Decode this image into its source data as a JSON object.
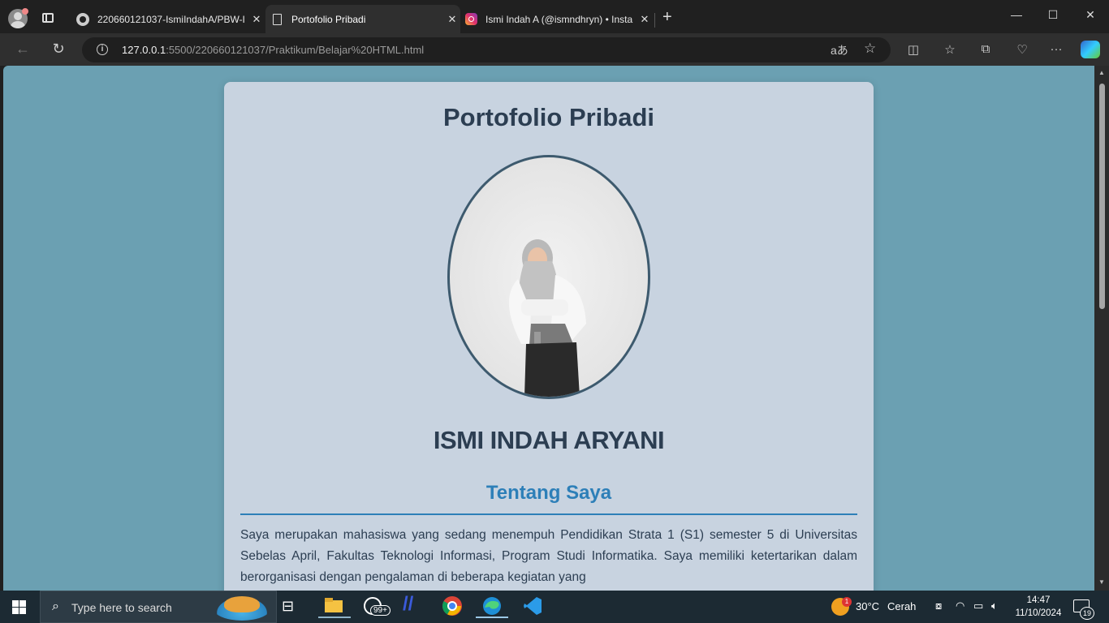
{
  "browser": {
    "tabs": [
      {
        "title": "220660121037-IsmiIndahA/PBW-I",
        "icon": "github-icon"
      },
      {
        "title": "Portofolio Pribadi",
        "icon": "document-icon"
      },
      {
        "title": "Ismi Indah A (@ismndhryn) • Insta",
        "icon": "instagram-icon"
      }
    ],
    "url_host": "127.0.0.1",
    "url_rest": ":5500/220660121037/Praktikum/Belajar%20HTML.html"
  },
  "page": {
    "title": "Portofolio Pribadi",
    "name": "ISMI INDAH ARYANI",
    "section_title": "Tentang Saya",
    "about_text": "Saya merupakan mahasiswa yang sedang menempuh Pendidikan Strata 1 (S1) semester 5 di Universitas Sebelas April, Fakultas Teknologi Informasi, Program Studi Informatika. Saya memiliki ketertarikan dalam berorganisasi dengan pengalaman di beberapa kegiatan yang"
  },
  "taskbar": {
    "search_placeholder": "Type here to search",
    "whatsapp_badge": "99+",
    "weather_badge": "1",
    "weather_temp": "30°C",
    "weather_desc": "Cerah",
    "time": "14:47",
    "date": "11/10/2024",
    "notification_count": "19"
  },
  "colors": {
    "page_background": "#6ba0b2",
    "card_background": "#c8d3e0",
    "heading": "#2c3e52",
    "accent": "#2d7fb8"
  }
}
